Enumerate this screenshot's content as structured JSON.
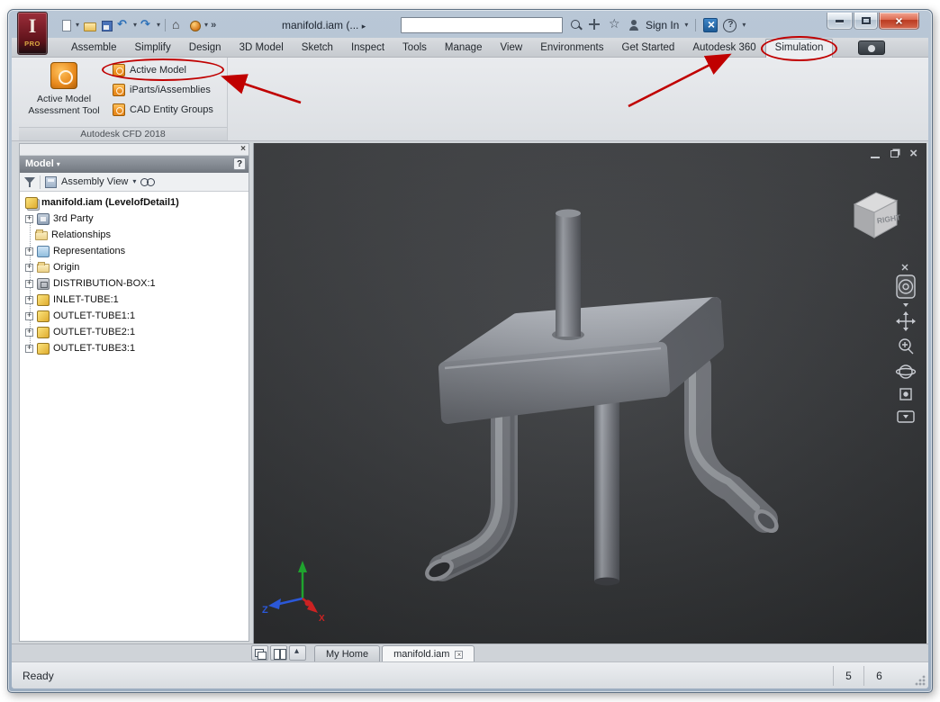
{
  "titlebar": {
    "doc_title": "manifold.iam (...",
    "sign_in": "Sign In"
  },
  "app_button": {
    "label": "PRO"
  },
  "ribbon": {
    "tabs": [
      "Assemble",
      "Simplify",
      "Design",
      "3D Model",
      "Sketch",
      "Inspect",
      "Tools",
      "Manage",
      "View",
      "Environments",
      "Get Started",
      "Autodesk 360",
      "Simulation"
    ],
    "active_tab": "Simulation",
    "cfd_panel": {
      "big_button_line1": "Active Model",
      "big_button_line2": "Assessment Tool",
      "small_buttons": [
        "Active Model",
        "iParts/iAssemblies",
        "CAD Entity Groups"
      ],
      "footer": "Autodesk CFD  2018"
    }
  },
  "browser": {
    "header": "Model",
    "help": "?",
    "view_selector": "Assembly View",
    "tree": [
      {
        "label": "manifold.iam (LevelofDetail1)"
      },
      {
        "label": "3rd Party"
      },
      {
        "label": "Relationships"
      },
      {
        "label": "Representations"
      },
      {
        "label": "Origin"
      },
      {
        "label": "DISTRIBUTION-BOX:1"
      },
      {
        "label": "INLET-TUBE:1"
      },
      {
        "label": "OUTLET-TUBE1:1"
      },
      {
        "label": "OUTLET-TUBE2:1"
      },
      {
        "label": "OUTLET-TUBE3:1"
      }
    ]
  },
  "viewport": {
    "viewcube_label": "RIGHT",
    "triad_x": "X",
    "triad_z": "Z"
  },
  "doc_tabs": {
    "home": "My Home",
    "document": "manifold.iam"
  },
  "statusbar": {
    "ready": "Ready",
    "value1": "5",
    "value2": "6"
  },
  "colors": {
    "annotation": "#c00000",
    "cfd_icon_orange": "#e8891c"
  },
  "icons": {
    "titlebar": [
      "new-icon",
      "open-icon",
      "save-icon",
      "undo-icon",
      "redo-icon",
      "home-icon",
      "render-icon",
      "search-icon",
      "selection-icon",
      "favorites-star-icon",
      "user-icon",
      "exchange-x-icon",
      "help-icon"
    ],
    "navbar": [
      "navwheel-icon",
      "pan-hand-icon",
      "zoom-icon",
      "orbit-icon",
      "look-at-icon"
    ]
  }
}
